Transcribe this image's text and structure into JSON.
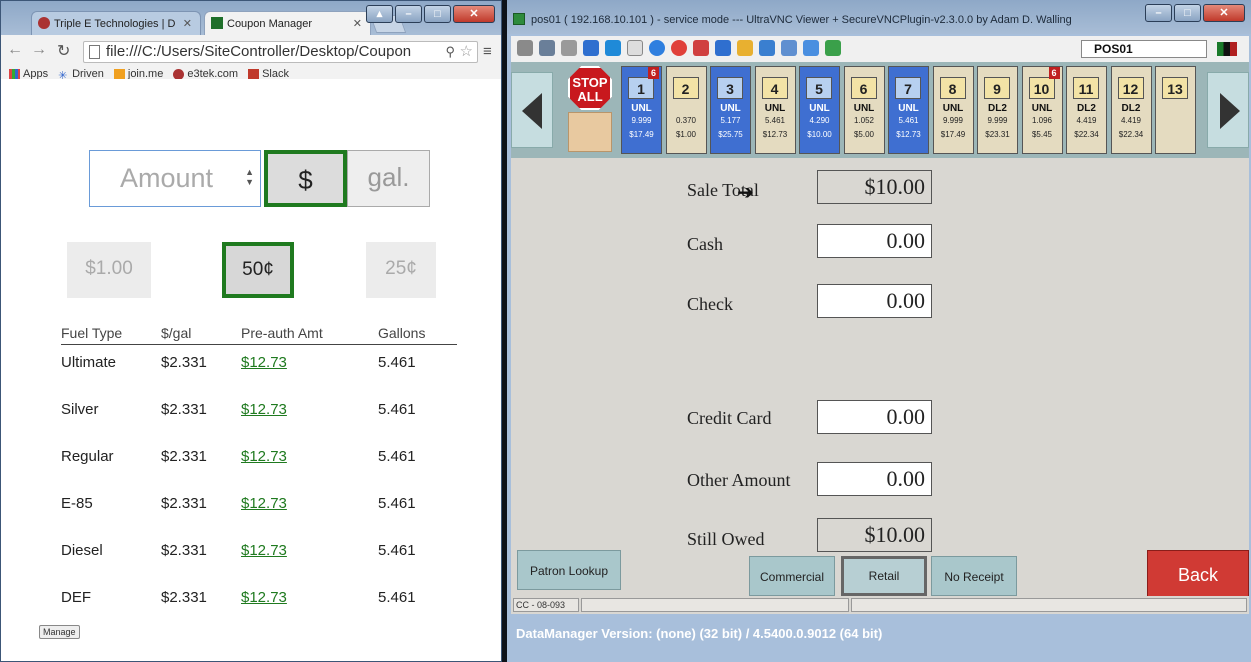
{
  "chrome": {
    "tabs": [
      {
        "title": "Triple E Technologies | D"
      },
      {
        "title": "Coupon Manager"
      }
    ],
    "address": "file:///C:/Users/SiteController/Desktop/Coupon",
    "bookmarks": [
      "Apps",
      "Driven",
      "join.me",
      "e3tek.com",
      "Slack"
    ],
    "page": {
      "amount_placeholder": "Amount",
      "unit_dollar": "$",
      "unit_gal": "gal.",
      "coins": [
        "$1.00",
        "50¢",
        "25¢"
      ],
      "table_headers": [
        "Fuel Type",
        "$/gal",
        "Pre-auth Amt",
        "Gallons"
      ],
      "rows": [
        {
          "type": "Ultimate",
          "price": "$2.331",
          "amt": "$12.73",
          "gal": "5.461"
        },
        {
          "type": "Silver",
          "price": "$2.331",
          "amt": "$12.73",
          "gal": "5.461"
        },
        {
          "type": "Regular",
          "price": "$2.331",
          "amt": "$12.73",
          "gal": "5.461"
        },
        {
          "type": "E-85",
          "price": "$2.331",
          "amt": "$12.73",
          "gal": "5.461"
        },
        {
          "type": "Diesel",
          "price": "$2.331",
          "amt": "$12.73",
          "gal": "5.461"
        },
        {
          "type": "DEF",
          "price": "$2.331",
          "amt": "$12.73",
          "gal": "5.461"
        }
      ],
      "manage": "Manage"
    }
  },
  "vnc": {
    "title": "pos01 ( 192.168.10.101 ) - service mode --- UltraVNC Viewer + SecureVNCPlugin-v2.3.0.0 by Adam D. Walling",
    "pos_name": "POS01",
    "stop_label": "STOP ALL",
    "pumps": [
      {
        "num": "1",
        "grade": "UNL",
        "gal": "9.999",
        "amt": "$17.49",
        "color": "blue",
        "badge": "6"
      },
      {
        "num": "2",
        "grade": "",
        "gal": "0.370",
        "amt": "$1.00",
        "color": "tan",
        "badge": ""
      },
      {
        "num": "3",
        "grade": "UNL",
        "gal": "5.177",
        "amt": "$25.75",
        "color": "blue",
        "badge": ""
      },
      {
        "num": "4",
        "grade": "UNL",
        "gal": "5.461",
        "amt": "$12.73",
        "color": "tan",
        "badge": ""
      },
      {
        "num": "5",
        "grade": "UNL",
        "gal": "4.290",
        "amt": "$10.00",
        "color": "blue",
        "badge": ""
      },
      {
        "num": "6",
        "grade": "UNL",
        "gal": "1.052",
        "amt": "$5.00",
        "color": "tan",
        "badge": ""
      },
      {
        "num": "7",
        "grade": "UNL",
        "gal": "5.461",
        "amt": "$12.73",
        "color": "blue",
        "badge": ""
      },
      {
        "num": "8",
        "grade": "UNL",
        "gal": "9.999",
        "amt": "$17.49",
        "color": "tan",
        "badge": ""
      },
      {
        "num": "9",
        "grade": "DL2",
        "gal": "9.999",
        "amt": "$23.31",
        "color": "tan",
        "badge": ""
      },
      {
        "num": "10",
        "grade": "UNL",
        "gal": "1.096",
        "amt": "$5.45",
        "color": "tan",
        "badge": "6"
      },
      {
        "num": "11",
        "grade": "DL2",
        "gal": "4.419",
        "amt": "$22.34",
        "color": "tan",
        "badge": ""
      },
      {
        "num": "12",
        "grade": "DL2",
        "gal": "4.419",
        "amt": "$22.34",
        "color": "tan",
        "badge": ""
      },
      {
        "num": "13",
        "grade": "",
        "gal": "",
        "amt": "",
        "color": "tan",
        "badge": ""
      }
    ],
    "fields": {
      "sale_total_label": "Sale Total",
      "sale_total": "$10.00",
      "cash_label": "Cash",
      "cash": "0.00",
      "check_label": "Check",
      "check": "0.00",
      "credit_label": "Credit Card",
      "credit": "0.00",
      "other_label": "Other Amount",
      "other": "0.00",
      "owed_label": "Still Owed",
      "owed": "$10.00"
    },
    "buttons": {
      "patron": "Patron Lookup",
      "commercial": "Commercial",
      "retail": "Retail",
      "no_receipt": "No Receipt",
      "back": "Back"
    },
    "status_cell": "CC - 08-093",
    "datamanager": "DataManager Version:     (none) (32 bit) / 4.5400.0.9012 (64 bit)"
  }
}
